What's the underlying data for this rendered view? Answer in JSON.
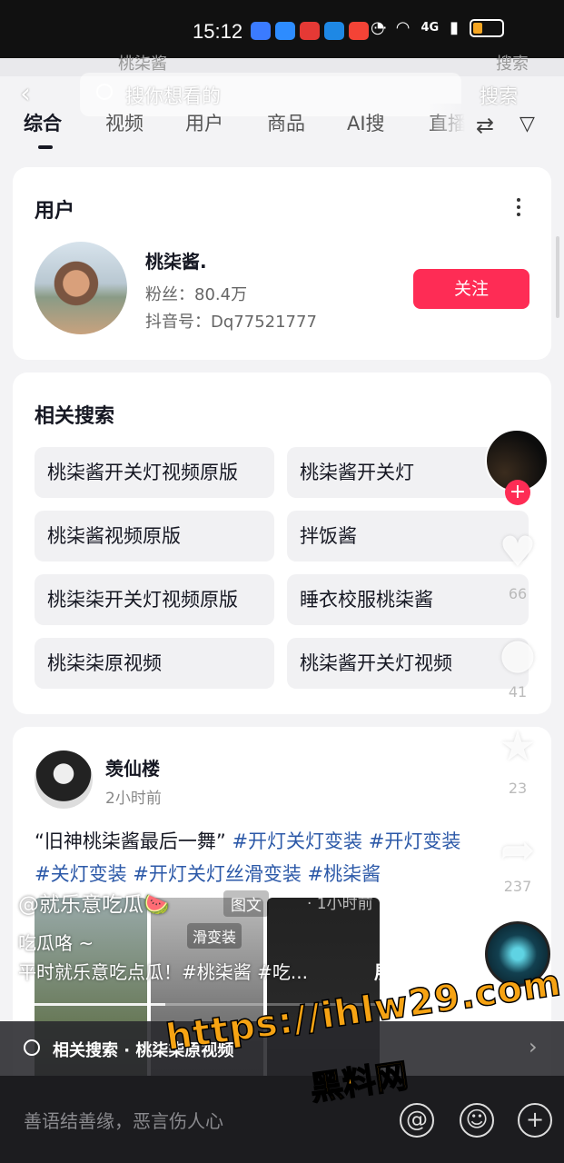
{
  "status_bar": {
    "time": "15:12",
    "dots": "···",
    "network": "4G"
  },
  "ghost_search": {
    "query": "桃柒酱",
    "button": "搜索"
  },
  "header": {
    "search_placeholder": "搜你想看的",
    "search_button": "搜索"
  },
  "tabs": [
    {
      "label": "综合",
      "active": true
    },
    {
      "label": "视频"
    },
    {
      "label": "用户"
    },
    {
      "label": "商品"
    },
    {
      "label": "AI搜"
    },
    {
      "label": "直播"
    }
  ],
  "user_card": {
    "title": "用户",
    "name": "桃柒酱.",
    "fans": "粉丝：80.4万",
    "douyin_id": "抖音号：Dq77521777",
    "follow_label": "关注"
  },
  "related": {
    "title": "相关搜索",
    "items": [
      "桃柒酱开关灯视频原版",
      "桃柒酱开关灯",
      "桃柒酱视频原版",
      "拌饭酱",
      "桃柒柒开关灯视频原版",
      "睡衣校服桃柒酱",
      "桃柒柒原视频",
      "桃柒酱开关灯视频"
    ]
  },
  "post": {
    "author": "羡仙楼",
    "time": "2小时前",
    "text_quote": "“旧神桃柒酱最后一舞”",
    "tags_line1": "#开灯关灯变装 #开灯变装",
    "tags_line2": "#关灯变装 #开灯关灯丝滑变装 #桃柒酱",
    "image_badge": "滑变装"
  },
  "rail": {
    "likes": "66",
    "comments": "41",
    "favorites": "23",
    "shares": "237"
  },
  "overlay": {
    "author": "@就乐意吃瓜🍉",
    "type_tag": "图文",
    "time": "· 1小时前",
    "line1": "吃瓜咯 ~",
    "line2": "平时就乐意吃点瓜！#桃柒酱 #吃...",
    "expand": "展开",
    "progress": 0.28
  },
  "related_bar": {
    "text": "相关搜索 · 桃柒柒原视频"
  },
  "comment_bar": {
    "placeholder": "善语结善缘，恶言伤人心"
  },
  "watermark": {
    "url": "https://ihlw29.com",
    "name": "黑料网"
  },
  "colors": {
    "accent": "#fe2c55",
    "tag": "#2c59a8",
    "watermark": "#f6a313"
  }
}
